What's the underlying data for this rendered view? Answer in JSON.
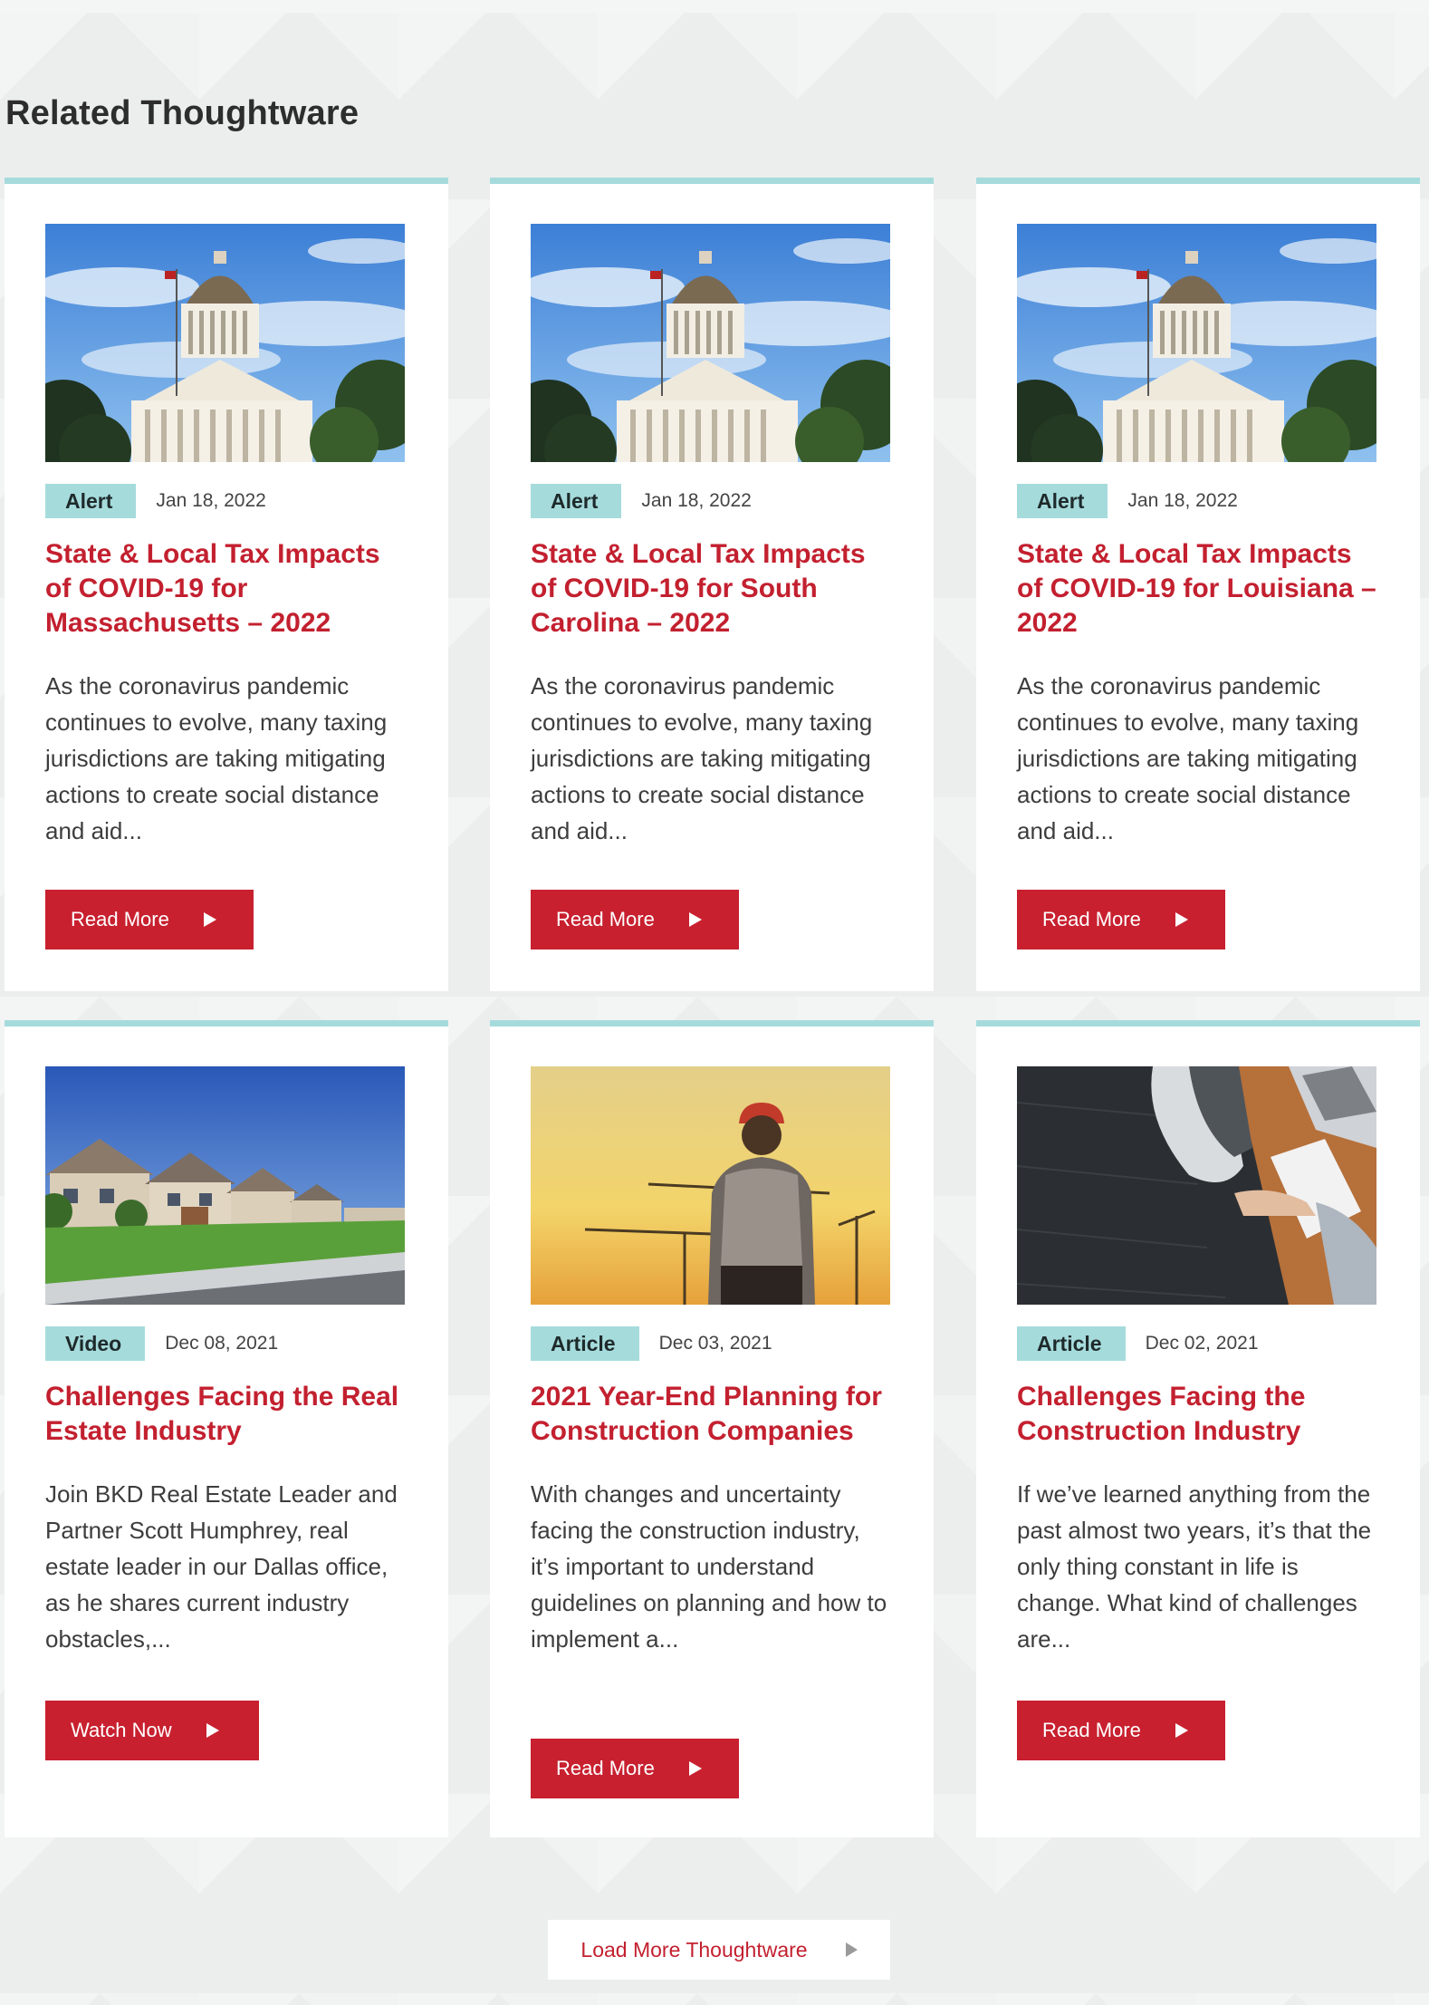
{
  "section": {
    "title": "Related Thoughtware"
  },
  "cards": [
    {
      "image": "capitol-photo",
      "badge": "Alert",
      "date": "Jan 18, 2022",
      "title": "State & Local Tax Impacts of COVID-19 for Massachusetts – 2022",
      "description": "As the coronavirus pandemic continues to evolve, many taxing jurisdictions are taking mitigating actions to create social distance and aid...",
      "button_label": "Read More"
    },
    {
      "image": "capitol-photo",
      "badge": "Alert",
      "date": "Jan 18, 2022",
      "title": "State & Local Tax Impacts of COVID-19 for South Carolina – 2022",
      "description": "As the coronavirus pandemic continues to evolve, many taxing jurisdictions are taking mitigating actions to create social distance and aid...",
      "button_label": "Read More"
    },
    {
      "image": "capitol-photo",
      "badge": "Alert",
      "date": "Jan 18, 2022",
      "title": "State & Local Tax Impacts of COVID-19 for Louisiana – 2022",
      "description": "As the coronavirus pandemic continues to evolve, many taxing jurisdictions are taking mitigating actions to create social distance and aid...",
      "button_label": "Read More"
    },
    {
      "image": "houses-photo",
      "badge": "Video",
      "date": "Dec 08, 2021",
      "title": "Challenges Facing the Real Estate Industry",
      "description": "Join BKD Real Estate Leader and Partner Scott Humphrey, real estate leader in our Dallas office, as he shares current industry obstacles,...",
      "button_label": "Watch Now"
    },
    {
      "image": "construction-worker-photo",
      "badge": "Article",
      "date": "Dec 03, 2021",
      "title": "2021 Year-End Planning for Construction Companies",
      "description": "With changes and uncertainty facing the construction industry, it’s important to understand guidelines on planning and how to implement a...",
      "button_label": "Read More"
    },
    {
      "image": "handshake-photo",
      "badge": "Article",
      "date": "Dec 02, 2021",
      "title": "Challenges Facing the Construction Industry",
      "description": "If we’ve learned anything from the past almost two years, it’s that the only thing constant in life is change. What kind of challenges are...",
      "button_label": "Read More"
    }
  ],
  "load_more": {
    "label": "Load More Thoughtware"
  },
  "colors": {
    "accent_red": "#c8202f",
    "badge_teal": "#a6dbdc",
    "title_red": "#c3202f"
  }
}
